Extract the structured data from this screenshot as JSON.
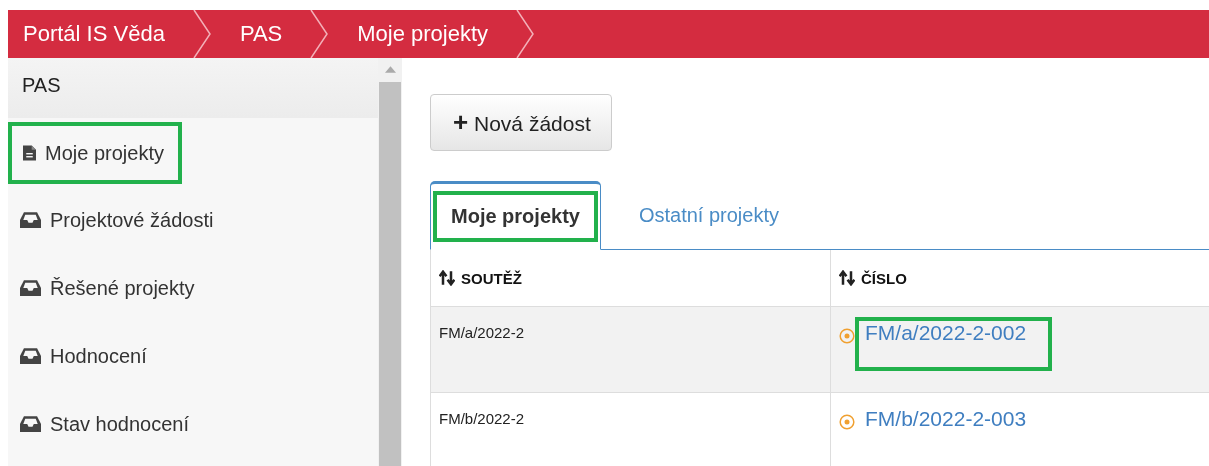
{
  "breadcrumb": [
    "Portál IS Věda",
    "PAS",
    "Moje projekty"
  ],
  "sidebar": {
    "title": "PAS",
    "items": [
      {
        "label": "Moje projekty",
        "kind": "document",
        "highlighted": true
      },
      {
        "label": "Projektové žádosti",
        "kind": "inbox",
        "highlighted": false
      },
      {
        "label": "Řešené projekty",
        "kind": "inbox",
        "highlighted": false
      },
      {
        "label": "Hodnocení",
        "kind": "inbox",
        "highlighted": false
      },
      {
        "label": "Stav hodnocení",
        "kind": "inbox",
        "highlighted": false
      }
    ]
  },
  "new_button": {
    "icon": "+",
    "label": "Nová žádost"
  },
  "tabs": [
    {
      "label": "Moje projekty",
      "selected": true,
      "highlighted": true
    },
    {
      "label": "Ostatní projekty",
      "selected": false,
      "highlighted": false
    }
  ],
  "table": {
    "columns": [
      "SOUTĚŽ",
      "ČÍSLO"
    ],
    "rows": [
      {
        "competition": "FM/a/2022-2",
        "number": "FM/a/2022-2-002",
        "highlighted": true,
        "shaded": true
      },
      {
        "competition": "FM/b/2022-2",
        "number": "FM/b/2022-2-003",
        "highlighted": false,
        "shaded": false
      }
    ]
  }
}
